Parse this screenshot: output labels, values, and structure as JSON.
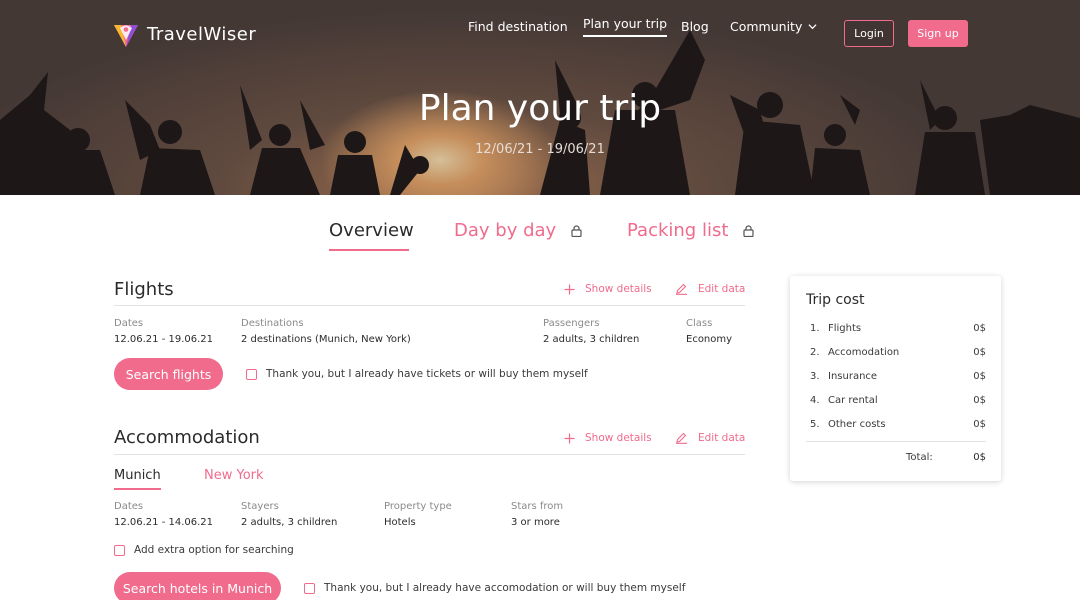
{
  "brand": {
    "name": "TravelWiser",
    "accent": "#f06b8c"
  },
  "nav": {
    "find_destination": "Find destination",
    "plan_your_trip": "Plan your trip",
    "blog": "Blog",
    "community": "Community",
    "login": "Login",
    "signup": "Sign up"
  },
  "hero": {
    "title": "Plan your trip",
    "dates": "12/06/21 - 19/06/21"
  },
  "tabs": {
    "overview": "Overview",
    "day_by_day": "Day by day",
    "packing_list": "Packing list"
  },
  "flights": {
    "title": "Flights",
    "show_details": "Show details",
    "edit_data": "Edit data",
    "dates_label": "Dates",
    "dates_value": "12.06.21 - 19.06.21",
    "destinations_label": "Destinations",
    "destinations_value": "2 destinations (Munich, New York)",
    "passengers_label": "Passengers",
    "passengers_value": "2 adults, 3 children",
    "class_label": "Class",
    "class_value": "Economy",
    "search_button": "Search flights",
    "already_have": "Thank you, but I already have tickets or will buy them myself"
  },
  "accommodation": {
    "title": "Accommodation",
    "show_details": "Show details",
    "edit_data": "Edit data",
    "cities": [
      "Munich",
      "New York"
    ],
    "dates_label": "Dates",
    "dates_value": "12.06.21 - 14.06.21",
    "stayers_label": "Stayers",
    "stayers_value": "2 adults, 3 children",
    "property_label": "Property type",
    "property_value": "Hotels",
    "stars_label": "Stars from",
    "stars_value": "3 or more",
    "extra_option": "Add extra option for searching",
    "search_button": "Search hotels in Munich",
    "already_have": "Thank you, but I already have accomodation or will buy them myself"
  },
  "trip_cost": {
    "title": "Trip cost",
    "items": [
      {
        "num": "1.",
        "name": "Flights",
        "amount": "0$"
      },
      {
        "num": "2.",
        "name": "Accomodation",
        "amount": "0$"
      },
      {
        "num": "3.",
        "name": "Insurance",
        "amount": "0$"
      },
      {
        "num": "4.",
        "name": "Car rental",
        "amount": "0$"
      },
      {
        "num": "5.",
        "name": "Other costs",
        "amount": "0$"
      }
    ],
    "total_label": "Total:",
    "total_amount": "0$"
  }
}
